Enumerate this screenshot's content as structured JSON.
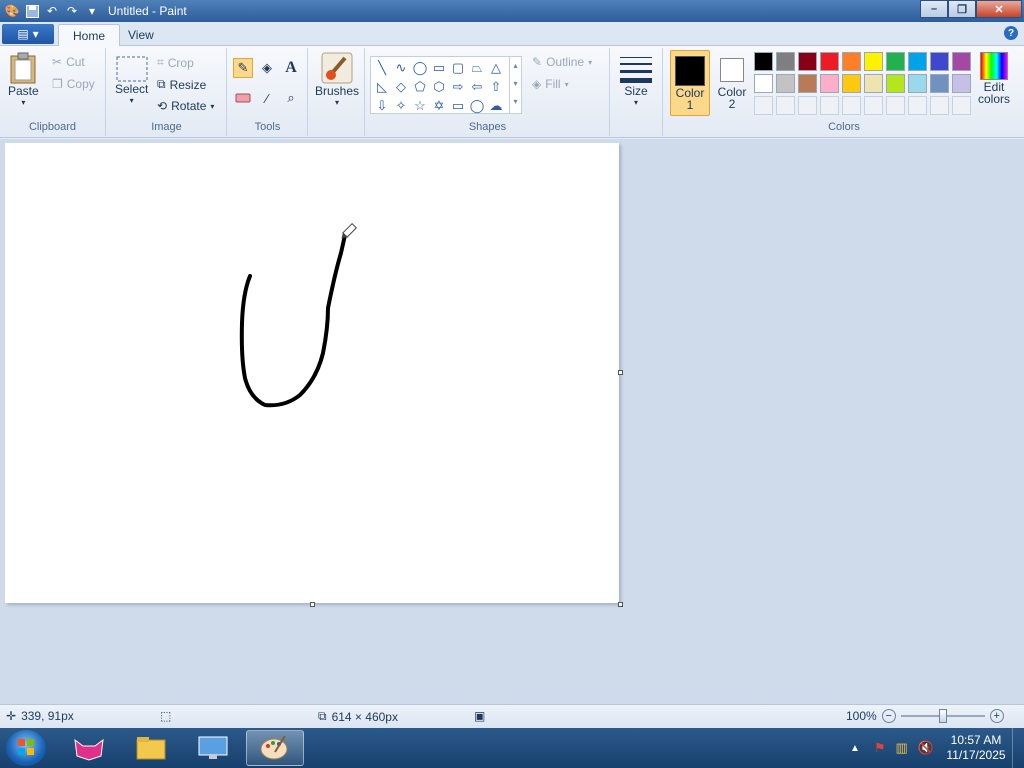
{
  "window": {
    "title": "Untitled - Paint",
    "minimize": "–",
    "maximize": "❐",
    "close": "✕"
  },
  "tabs": {
    "home": "Home",
    "view": "View",
    "help": "?"
  },
  "ribbon": {
    "clipboard": {
      "label": "Clipboard",
      "paste": "Paste",
      "cut": "Cut",
      "copy": "Copy"
    },
    "image": {
      "label": "Image",
      "select": "Select",
      "crop": "Crop",
      "resize": "Resize",
      "rotate": "Rotate"
    },
    "tools": {
      "label": "Tools"
    },
    "brushes": {
      "label": "Brushes"
    },
    "shapes": {
      "label": "Shapes",
      "outline": "Outline",
      "fill": "Fill"
    },
    "size": {
      "label": "Size"
    },
    "colors": {
      "label": "Colors",
      "color1": "Color",
      "color1_num": "1",
      "color2": "Color",
      "color2_num": "2",
      "edit": "Edit",
      "edit2": "colors",
      "primary": "#000000",
      "secondary": "#ffffff",
      "palette_row1": [
        "#000000",
        "#7f7f7f",
        "#880015",
        "#ed1c24",
        "#ff7f27",
        "#fff200",
        "#22b14c",
        "#00a2e8",
        "#3f48cc",
        "#a349a4"
      ],
      "palette_row2": [
        "#ffffff",
        "#c3c3c3",
        "#b97a57",
        "#ffaec9",
        "#ffc90e",
        "#efe4b0",
        "#b5e61d",
        "#99d9ea",
        "#7092be",
        "#c8bfe7"
      ]
    }
  },
  "status": {
    "cursor_pos": "339, 91px",
    "canvas_size": "614 × 460px",
    "zoom": "100%",
    "zoom_level": 0.5
  },
  "taskbar": {
    "time": "10:57 AM",
    "date": "11/17/2025"
  }
}
